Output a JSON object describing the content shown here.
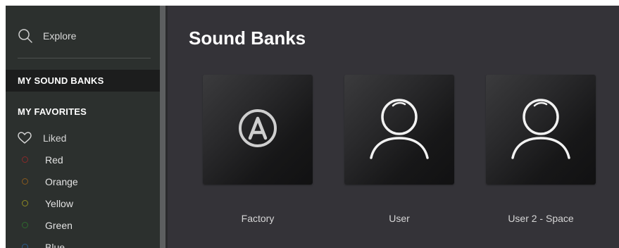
{
  "sidebar": {
    "search_label": "Explore",
    "my_sound_banks": "MY SOUND BANKS",
    "my_favorites": "MY FAVORITES",
    "favorites": [
      {
        "label": "Liked",
        "icon": "heart-icon"
      },
      {
        "label": "Red",
        "color": "#8a2a2a"
      },
      {
        "label": "Orange",
        "color": "#8a5a1e"
      },
      {
        "label": "Yellow",
        "color": "#8e8a24"
      },
      {
        "label": "Green",
        "color": "#2f6a2e"
      },
      {
        "label": "Blue",
        "color": "#2a5a8a"
      }
    ]
  },
  "main": {
    "title": "Sound Banks",
    "banks": [
      {
        "name": "Factory",
        "icon": "arturia-logo-icon"
      },
      {
        "name": "User",
        "icon": "user-icon"
      },
      {
        "name": "User 2 - Space",
        "icon": "user-icon"
      }
    ]
  },
  "colors": {
    "sidebar_bg": "#2c302e",
    "main_bg": "#343338",
    "selected_bg": "#1c1d1d"
  }
}
